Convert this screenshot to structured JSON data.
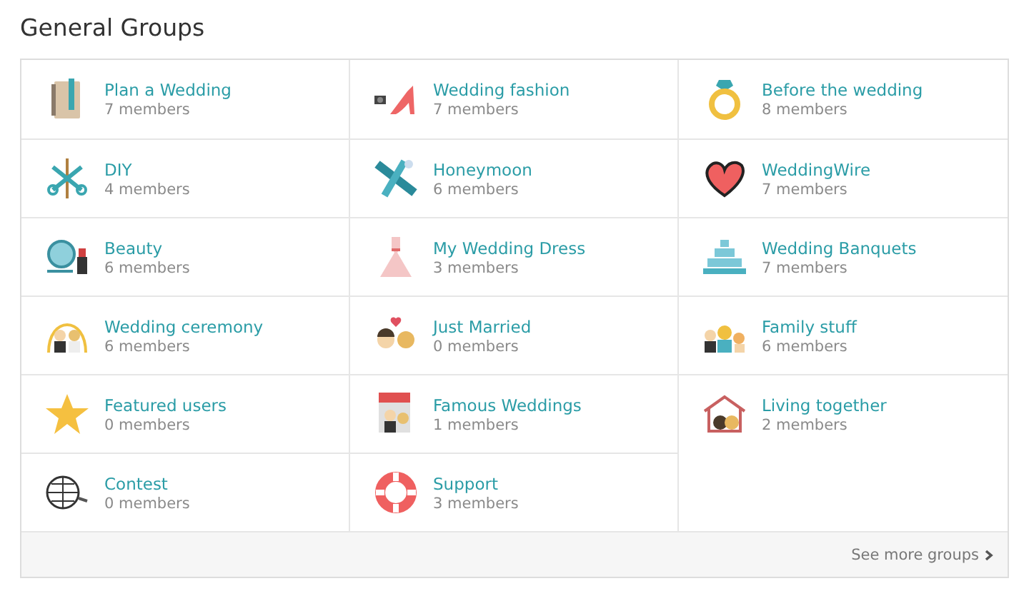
{
  "title": "General Groups",
  "groups": [
    {
      "name": "Plan a Wedding",
      "members": "7 members"
    },
    {
      "name": "Wedding fashion",
      "members": "7 members"
    },
    {
      "name": "Before the wedding",
      "members": "8 members"
    },
    {
      "name": "DIY",
      "members": "4 members"
    },
    {
      "name": "Honeymoon",
      "members": "6 members"
    },
    {
      "name": "WeddingWire",
      "members": "7 members"
    },
    {
      "name": "Beauty",
      "members": "6 members"
    },
    {
      "name": "My Wedding Dress",
      "members": "3 members"
    },
    {
      "name": "Wedding Banquets",
      "members": "7 members"
    },
    {
      "name": "Wedding ceremony",
      "members": "6 members"
    },
    {
      "name": "Just Married",
      "members": "0 members"
    },
    {
      "name": "Family stuff",
      "members": "6 members"
    },
    {
      "name": "Featured users",
      "members": "0 members"
    },
    {
      "name": "Famous Weddings",
      "members": "1 members"
    },
    {
      "name": "Living together",
      "members": "2 members"
    },
    {
      "name": "Contest",
      "members": "0 members"
    },
    {
      "name": "Support",
      "members": "3 members"
    }
  ],
  "footer_link": "See more groups"
}
